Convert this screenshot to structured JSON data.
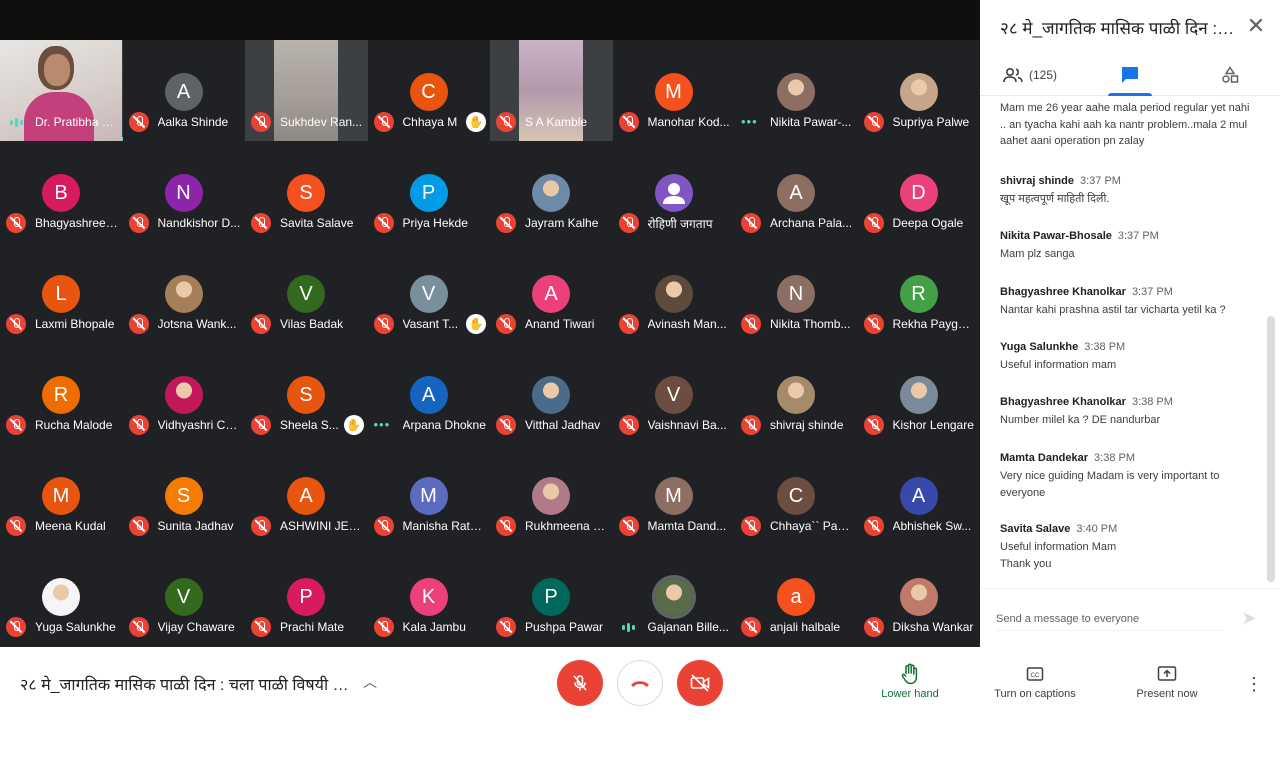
{
  "meeting": {
    "title": "२८ मे_जागतिक मासिक पाळी दिन : चला पाळी विषयी बो...",
    "panel_title": "२८ मे_जागतिक मासिक पाळी दिन : च..."
  },
  "colors": {
    "accent": "#1a73e8",
    "danger": "#ea4335",
    "grid_bg": "#202124",
    "talking": "#5ad5be",
    "hand_lowered": "#137333"
  },
  "participants": [
    {
      "name": "Dr. Pratibha G...",
      "kind": "video",
      "status": "talking"
    },
    {
      "name": "Aalka Shinde",
      "initial": "A",
      "color": "#5f6368",
      "status": "muted"
    },
    {
      "name": "Sukhdev Ran...",
      "kind": "video",
      "status": "muted"
    },
    {
      "name": "Chhaya M",
      "initial": "C",
      "color": "#e8550e",
      "status": "muted",
      "hand": true
    },
    {
      "name": "S A Kamble",
      "kind": "video",
      "status": "muted"
    },
    {
      "name": "Manohar Kod...",
      "initial": "M",
      "color": "#f4511e",
      "status": "muted"
    },
    {
      "name": "Nikita Pawar-...",
      "kind": "photo",
      "photo_color": "#8d6e63",
      "status": "speaking-dots"
    },
    {
      "name": "Supriya Palwe",
      "kind": "photo",
      "photo_color": "#c5a68a",
      "status": "muted"
    },
    {
      "name": "Bhagyashree ...",
      "initial": "B",
      "color": "#d81b60",
      "status": "muted"
    },
    {
      "name": "Nandkishor D...",
      "initial": "N",
      "color": "#8e24aa",
      "status": "muted"
    },
    {
      "name": "Savita Salave",
      "initial": "S",
      "color": "#f4511e",
      "status": "muted"
    },
    {
      "name": "Priya Hekde",
      "initial": "P",
      "color": "#039be5",
      "status": "muted"
    },
    {
      "name": "Jayram Kalhe",
      "kind": "photo",
      "photo_color": "#6d8aa8",
      "status": "muted"
    },
    {
      "name": "रोहिणी जगताप",
      "initial": "",
      "color": "#7e57c2",
      "status": "muted",
      "person_icon": true
    },
    {
      "name": "Archana Pala...",
      "initial": "A",
      "color": "#8d6e63",
      "status": "muted"
    },
    {
      "name": "Deepa Ogale",
      "initial": "D",
      "color": "#ec407a",
      "status": "muted"
    },
    {
      "name": "Laxmi Bhopale",
      "initial": "L",
      "color": "#e8550e",
      "status": "muted"
    },
    {
      "name": "Jotsna Wank...",
      "kind": "photo",
      "photo_color": "#a57f5a",
      "status": "muted"
    },
    {
      "name": "Vilas Badak",
      "initial": "V",
      "color": "#33691e",
      "status": "muted"
    },
    {
      "name": "Vasant T...",
      "initial": "V",
      "color": "#78909c",
      "status": "muted",
      "hand": true
    },
    {
      "name": "Anand Tiwari",
      "initial": "A",
      "color": "#ec407a",
      "status": "muted"
    },
    {
      "name": "Avinash Man...",
      "kind": "photo",
      "photo_color": "#5d4a3a",
      "status": "muted"
    },
    {
      "name": "Nikita Thomb...",
      "initial": "N",
      "color": "#8d6e63",
      "status": "muted"
    },
    {
      "name": "Rekha Payghan",
      "initial": "R",
      "color": "#43a047",
      "status": "muted"
    },
    {
      "name": "Rucha Malode",
      "initial": "R",
      "color": "#ef6c00",
      "status": "muted"
    },
    {
      "name": "Vidhyashri Ch...",
      "kind": "photo",
      "photo_color": "#c2185b",
      "status": "muted"
    },
    {
      "name": "Sheela S...",
      "initial": "S",
      "color": "#e8550e",
      "status": "muted",
      "hand": true
    },
    {
      "name": "Arpana Dhokne",
      "initial": "A",
      "color": "#1565c0",
      "status": "speaking-dots"
    },
    {
      "name": "Vitthal Jadhav",
      "kind": "photo",
      "photo_color": "#4a6b8a",
      "status": "muted"
    },
    {
      "name": "Vaishnavi Ba...",
      "initial": "V",
      "color": "#6d4c41",
      "status": "muted"
    },
    {
      "name": "shivraj shinde",
      "kind": "photo",
      "photo_color": "#a68a6a",
      "status": "muted"
    },
    {
      "name": "Kishor Lengare",
      "kind": "photo",
      "photo_color": "#7a8a9a",
      "status": "muted"
    },
    {
      "name": "Meena Kudal",
      "initial": "M",
      "color": "#e8550e",
      "status": "muted"
    },
    {
      "name": "Sunita Jadhav",
      "initial": "S",
      "color": "#f57c00",
      "status": "muted"
    },
    {
      "name": "ASHWINI JET...",
      "initial": "A",
      "color": "#e8550e",
      "status": "muted"
    },
    {
      "name": "Manisha Rath...",
      "initial": "M",
      "color": "#5c6bc0",
      "status": "muted"
    },
    {
      "name": "Rukhmeena G...",
      "kind": "photo",
      "photo_color": "#b07a8a",
      "status": "muted"
    },
    {
      "name": "Mamta Dand...",
      "initial": "M",
      "color": "#8d6e63",
      "status": "muted"
    },
    {
      "name": "Chhaya`` Pag...",
      "initial": "C",
      "color": "#6d4c41",
      "status": "muted"
    },
    {
      "name": "Abhishek Sw...",
      "initial": "A",
      "color": "#3949ab",
      "status": "muted"
    },
    {
      "name": "Yuga Salunkhe",
      "kind": "photo",
      "photo_color": "#f5f5f5",
      "status": "muted"
    },
    {
      "name": "Vijay Chaware",
      "initial": "V",
      "color": "#33691e",
      "status": "muted"
    },
    {
      "name": "Prachi Mate",
      "initial": "P",
      "color": "#d81b60",
      "status": "muted"
    },
    {
      "name": "Kala Jambu",
      "initial": "K",
      "color": "#ec407a",
      "status": "muted"
    },
    {
      "name": "Pushpa Pawar",
      "initial": "P",
      "color": "#00695c",
      "status": "muted"
    },
    {
      "name": "Gajanan Bille...",
      "kind": "photo",
      "photo_color": "#5a6b4a",
      "status": "talking",
      "ring": true
    },
    {
      "name": "anjali halbale",
      "initial": "a",
      "color": "#f4511e",
      "status": "muted"
    },
    {
      "name": "Diksha Wankar",
      "kind": "photo",
      "photo_color": "#c07a6a",
      "status": "muted"
    }
  ],
  "panel": {
    "participants_count": "(125)",
    "chat_input_placeholder": "Send a message to everyone",
    "messages": [
      {
        "sender": "",
        "time": "",
        "text": "Mam  me 26 year aahe mala period  regular yet nahi ..  an tyacha kahi  aah ka nantr problem..mala 2 mul aahet aani operation pn zalay"
      },
      {
        "sender": "shivraj shinde",
        "time": "3:37 PM",
        "text": "खूप महत्वपूर्ण माहिती दिली."
      },
      {
        "sender": "Nikita Pawar-Bhosale",
        "time": "3:37 PM",
        "text": "Mam plz sanga"
      },
      {
        "sender": "Bhagyashree Khanolkar",
        "time": "3:37 PM",
        "text": "Nantar kahi prashna astil tar vicharta yetil ka ?"
      },
      {
        "sender": "Yuga Salunkhe",
        "time": "3:38 PM",
        "text": "Useful information mam"
      },
      {
        "sender": "Bhagyashree Khanolkar",
        "time": "3:38 PM",
        "text": "Number milel ka ? DE nandurbar"
      },
      {
        "sender": "Mamta Dandekar",
        "time": "3:38 PM",
        "text": "Very nice guiding Madam is very important to everyone"
      },
      {
        "sender": "Savita Salave",
        "time": "3:40 PM",
        "text": "Useful information Mam\nThank you"
      }
    ]
  },
  "controls": {
    "lower_hand": "Lower hand",
    "captions": "Turn on captions",
    "present": "Present now"
  }
}
